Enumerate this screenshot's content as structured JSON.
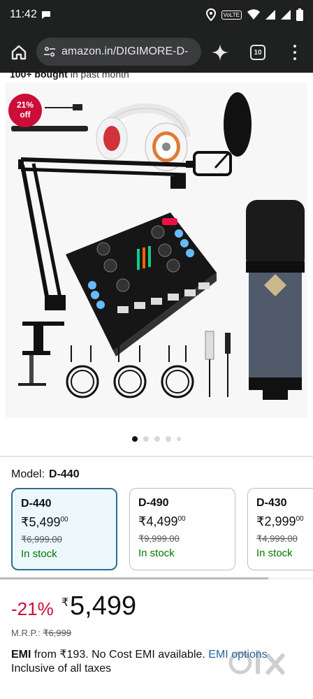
{
  "status_bar": {
    "time": "11:42",
    "icons": [
      "chat-bubble-icon",
      "location-icon",
      "volte-icon",
      "wifi-icon",
      "signal-icon",
      "signal-icon",
      "battery-icon"
    ],
    "volte_label": "VoLTE"
  },
  "browser": {
    "url": "amazon.in/DIGIMORE-D-",
    "tab_count": "10"
  },
  "bought_text": {
    "bold": "100+ bought",
    "rest": " in past month"
  },
  "product": {
    "discount_badge_pct": "21%",
    "discount_badge_off": "off",
    "image_dots": 5,
    "active_dot": 0
  },
  "model": {
    "label": "Model:",
    "value": "D-440"
  },
  "variants": [
    {
      "name": "D-440",
      "price": "₹5,499",
      "price_sup": "00",
      "mrp": "₹6,999.00",
      "stock": "In stock"
    },
    {
      "name": "D-490",
      "price": "₹4,499",
      "price_sup": "00",
      "mrp": "₹9,999.00",
      "stock": "In stock"
    },
    {
      "name": "D-430",
      "price": "₹2,999",
      "price_sup": "00",
      "mrp": "₹4,999.00",
      "stock": "In stock"
    }
  ],
  "price": {
    "discount": "-21%",
    "symbol": "₹",
    "value": "5,499"
  },
  "mrp": {
    "label": "M.R.P.: ",
    "value": "₹6,999"
  },
  "emi": {
    "bold": "EMI",
    "text": " from ₹193. No Cost EMI available. ",
    "link": "EMI options"
  },
  "tax_text": "Inclusive of all taxes",
  "colors": {
    "accent_red": "#cc0c39",
    "link_blue": "#2162a1",
    "stock_green": "#007600",
    "selected_border": "#2c6c94"
  }
}
